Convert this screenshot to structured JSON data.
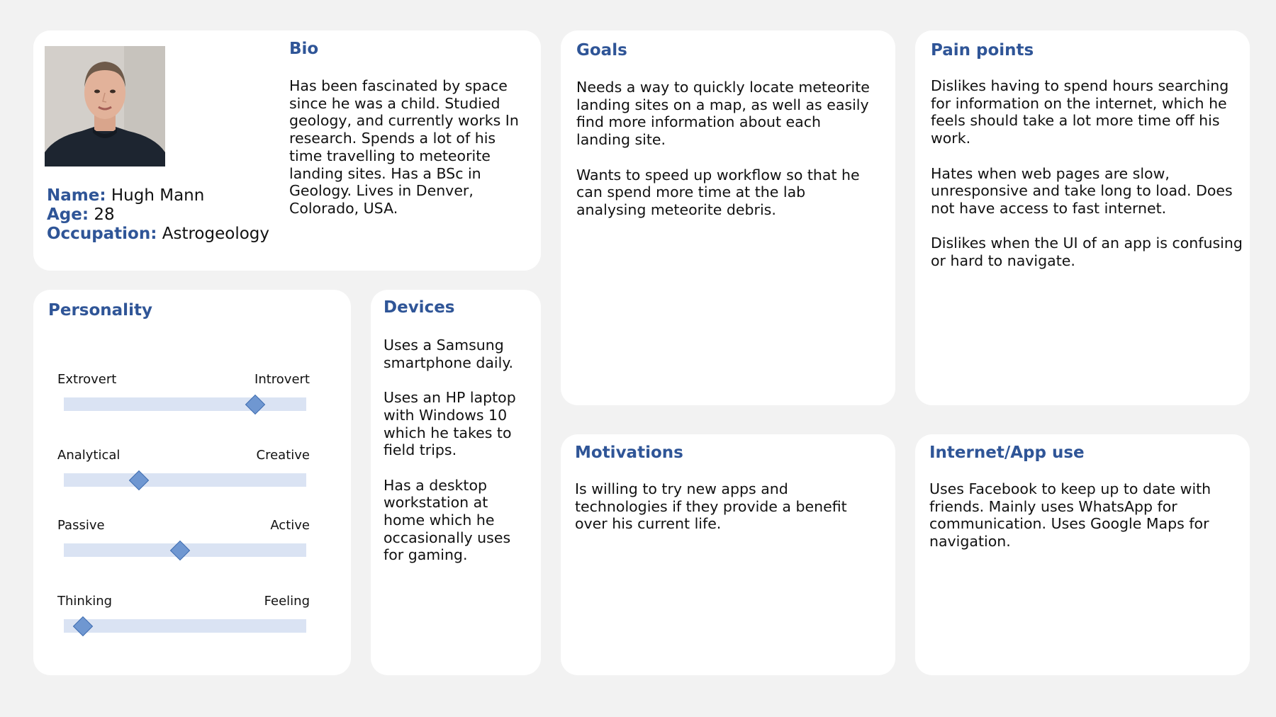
{
  "profile": {
    "photo_alt": "Profile photo",
    "name_label": "Name:",
    "name_value": "Hugh Mann",
    "age_label": "Age:",
    "age_value": "28",
    "occupation_label": "Occupation:",
    "occupation_value": "Astrogeology"
  },
  "bio": {
    "title": "Bio",
    "text": "Has been fascinated by space since he was a child. Studied geology, and currently works In research. Spends a lot of his time travelling to meteorite landing sites. Has a BSc in Geology. Lives in Denver, Colorado, USA."
  },
  "personality": {
    "title": "Personality",
    "traits": [
      {
        "left": "Extrovert",
        "right": "Introvert",
        "position": 0.79
      },
      {
        "left": "Analytical",
        "right": "Creative",
        "position": 0.31
      },
      {
        "left": "Passive",
        "right": "Active",
        "position": 0.48
      },
      {
        "left": "Thinking",
        "right": "Feeling",
        "position": 0.08
      }
    ]
  },
  "devices": {
    "title": "Devices",
    "paragraphs": [
      "Uses a Samsung smartphone daily.",
      "Uses an HP laptop with Windows 10 which he takes to field trips.",
      "Has a desktop workstation at home which he occasionally uses for gaming."
    ]
  },
  "goals": {
    "title": "Goals",
    "paragraphs": [
      "Needs a way to quickly locate meteorite landing sites on a map, as well as easily find more information about each landing site.",
      "Wants to speed up workflow so that he can spend more time at the lab analysing meteorite debris."
    ]
  },
  "pain_points": {
    "title": "Pain points",
    "paragraphs": [
      "Dislikes having to spend hours searching for information on the internet, which he feels should take a lot more time off his work.",
      "Hates when web pages are slow, unresponsive and take long to load. Does not have access to fast internet.",
      "Dislikes when the UI of an app is confusing or hard to navigate."
    ]
  },
  "motivations": {
    "title": "Motivations",
    "paragraphs": [
      "Is willing to try new apps and technologies if they provide a benefit over his current life."
    ]
  },
  "internet_app_use": {
    "title": "Internet/App use",
    "paragraphs": [
      "Uses Facebook to keep up to date with friends. Mainly uses WhatsApp for communication. Uses Google Maps for navigation."
    ]
  },
  "colors": {
    "background": "#f2f2f2",
    "card": "#ffffff",
    "heading": "#2f5597",
    "track": "#dae3f3",
    "marker": "#6f97d1"
  }
}
